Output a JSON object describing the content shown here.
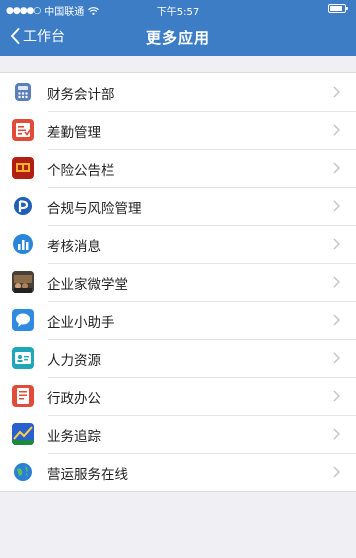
{
  "status_bar": {
    "signal": "●●●●○",
    "carrier": "中国联通",
    "time": "下午5:57"
  },
  "nav": {
    "back_label": "工作台",
    "title": "更多应用"
  },
  "colors": {
    "header": "#3d7dc6",
    "background": "#efeff4"
  },
  "apps": [
    {
      "label": "财务会计部",
      "icon": "calculator-icon"
    },
    {
      "label": "差勤管理",
      "icon": "attendance-icon"
    },
    {
      "label": "个险公告栏",
      "icon": "bulletin-icon"
    },
    {
      "label": "合规与风险管理",
      "icon": "compliance-icon"
    },
    {
      "label": "考核消息",
      "icon": "chart-icon"
    },
    {
      "label": "企业家微学堂",
      "icon": "classroom-icon"
    },
    {
      "label": "企业小助手",
      "icon": "chat-bubble-icon"
    },
    {
      "label": "人力资源",
      "icon": "id-card-icon"
    },
    {
      "label": "行政办公",
      "icon": "office-icon"
    },
    {
      "label": "业务追踪",
      "icon": "tracking-icon"
    },
    {
      "label": "营运服务在线",
      "icon": "globe-icon"
    }
  ]
}
